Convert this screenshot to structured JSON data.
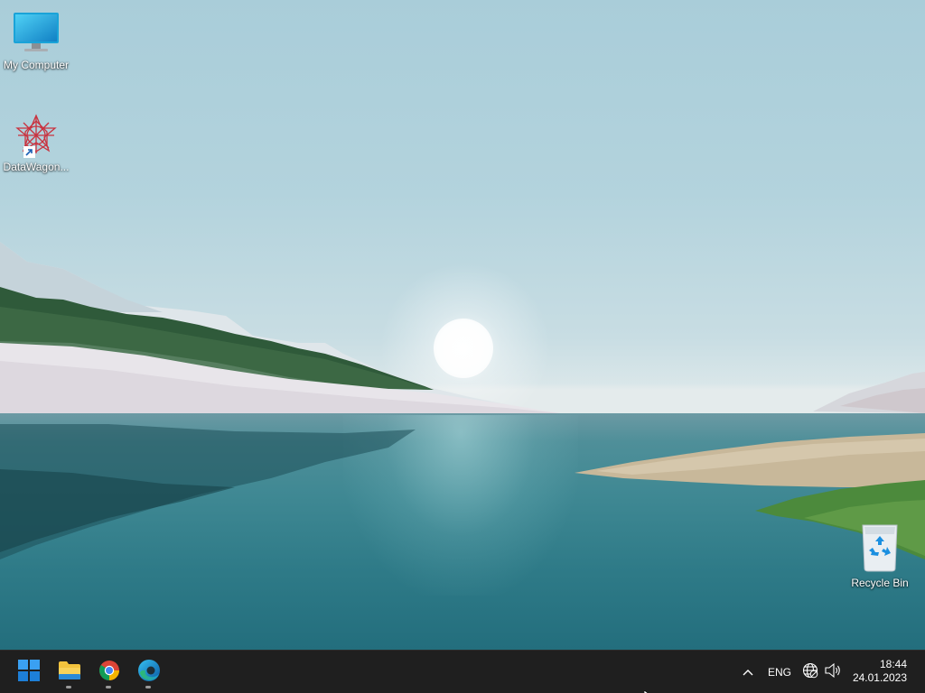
{
  "desktop": {
    "icons": [
      {
        "label": "My Computer",
        "icon": "monitor-icon"
      },
      {
        "label": "DataWagon...",
        "icon": "datawagon-app-icon",
        "shortcut": true
      },
      {
        "label": "Recycle Bin",
        "icon": "recycle-bin-icon"
      }
    ]
  },
  "taskbar": {
    "start_icon": "windows-start-icon",
    "pinned": [
      {
        "name": "File Explorer",
        "icon": "folder-icon",
        "running": true
      },
      {
        "name": "Google Chrome",
        "icon": "chrome-icon",
        "running": true
      },
      {
        "name": "Microsoft Edge",
        "icon": "edge-icon",
        "running": true
      }
    ],
    "tray": {
      "overflow_icon": "chevron-up-icon",
      "language": "ENG",
      "network_icon": "globe-icon",
      "volume_icon": "speaker-icon"
    },
    "clock": {
      "time": "18:44",
      "date": "24.01.2023"
    }
  },
  "colors": {
    "taskbar_bg": "#1f1f1f",
    "start_blue": "#1d9bf0"
  }
}
